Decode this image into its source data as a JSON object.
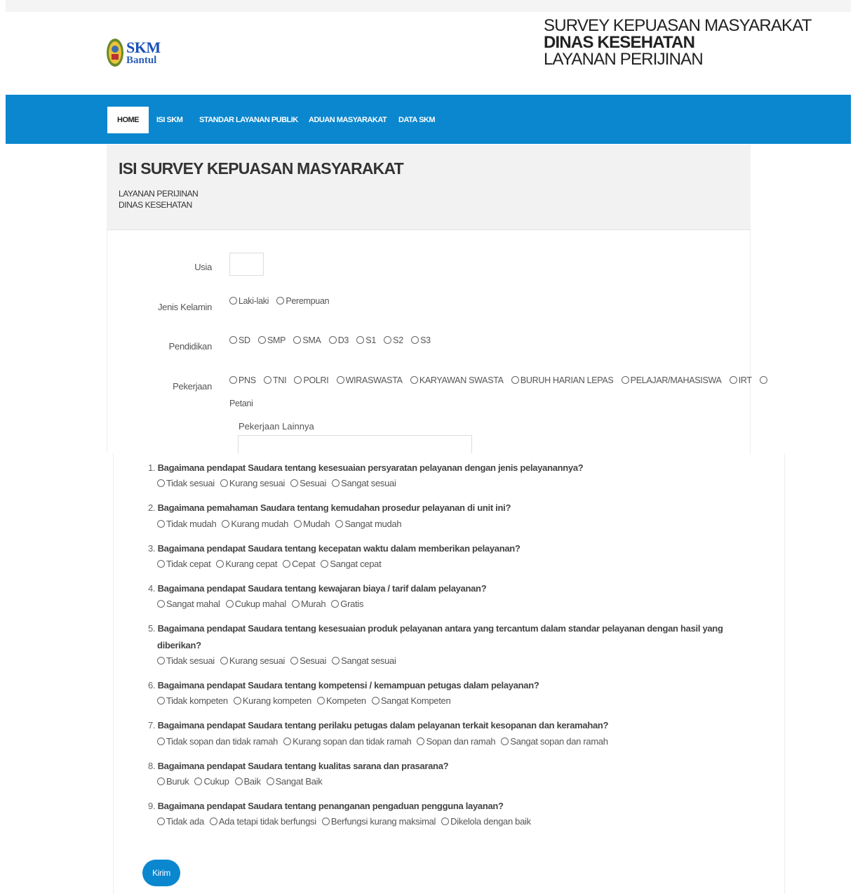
{
  "logo": {
    "line1": "SKM",
    "line2": "Bantul"
  },
  "header": {
    "line1": "SURVEY KEPUASAN MASYARAKAT",
    "line2": "DINAS KESEHATAN",
    "line3": "LAYANAN PERIJINAN"
  },
  "nav": [
    "HOME",
    "ISI SKM",
    "STANDAR LAYANAN PUBLIK",
    "ADUAN MASYARAKAT",
    "DATA SKM"
  ],
  "page": {
    "title": "ISI SURVEY KEPUASAN MASYARAKAT",
    "sub1": "LAYANAN PERIJINAN",
    "sub2": "DINAS KESEHATAN"
  },
  "form": {
    "usia_label": "Usia",
    "jk_label": "Jenis Kelamin",
    "jk_options": [
      "Laki-laki",
      "Perempuan"
    ],
    "pend_label": "Pendidikan",
    "pend_options": [
      "SD",
      "SMP",
      "SMA",
      "D3",
      "S1",
      "S2",
      "S3"
    ],
    "pek_label": "Pekerjaan",
    "pek_options": [
      "PNS",
      "TNI",
      "POLRI",
      "WIRASWASTA",
      "KARYAWAN SWASTA",
      "BURUH HARIAN LEPAS",
      "PELAJAR/MAHASISWA",
      "IRT"
    ],
    "pek_last": "Petani",
    "pek_other_label": "Pekerjaan Lainnya"
  },
  "questions": [
    {
      "num": "1.",
      "text": "Bagaimana pendapat Saudara tentang kesesuaian persyaratan pelayanan dengan jenis pelayanannya?",
      "options": [
        "Tidak sesuai",
        "Kurang sesuai",
        "Sesuai",
        "Sangat sesuai"
      ]
    },
    {
      "num": "2.",
      "text": "Bagaimana pemahaman Saudara tentang kemudahan prosedur pelayanan di unit ini?",
      "options": [
        "Tidak mudah",
        "Kurang mudah",
        "Mudah",
        "Sangat mudah"
      ]
    },
    {
      "num": "3.",
      "text": "Bagaimana pendapat Saudara tentang kecepatan waktu dalam memberikan pelayanan?",
      "options": [
        "Tidak cepat",
        "Kurang cepat",
        "Cepat",
        "Sangat cepat"
      ]
    },
    {
      "num": "4.",
      "text": "Bagaimana pendapat Saudara tentang kewajaran biaya / tarif dalam pelayanan?",
      "options": [
        "Sangat mahal",
        "Cukup mahal",
        "Murah",
        "Gratis"
      ]
    },
    {
      "num": "5.",
      "text": "Bagaimana pendapat Saudara tentang kesesuaian produk pelayanan antara yang tercantum dalam standar pelayanan dengan hasil yang diberikan?",
      "options": [
        "Tidak sesuai",
        "Kurang sesuai",
        "Sesuai",
        "Sangat sesuai"
      ]
    },
    {
      "num": "6.",
      "text": "Bagaimana pendapat Saudara tentang kompetensi / kemampuan petugas dalam pelayanan?",
      "options": [
        "Tidak kompeten",
        "Kurang kompeten",
        "Kompeten",
        "Sangat Kompeten"
      ]
    },
    {
      "num": "7.",
      "text": "Bagaimana pendapat Saudara tentang perilaku petugas dalam pelayanan terkait kesopanan dan keramahan?",
      "options": [
        "Tidak sopan dan tidak ramah",
        "Kurang sopan dan tidak ramah",
        "Sopan dan ramah",
        "Sangat sopan dan ramah"
      ]
    },
    {
      "num": "8.",
      "text": "Bagaimana pendapat Saudara tentang kualitas sarana dan prasarana?",
      "options": [
        "Buruk",
        "Cukup",
        "Baik",
        "Sangat Baik"
      ]
    },
    {
      "num": "9.",
      "text": "Bagaimana pendapat Saudara tentang penanganan pengaduan pengguna layanan?",
      "options": [
        "Tidak ada",
        "Ada tetapi tidak berfungsi",
        "Berfungsi kurang maksimal",
        "Dikelola dengan baik"
      ]
    }
  ],
  "submit_label": "Kirim",
  "colors": {
    "nav": "#0a87cf",
    "button": "#0a87cf"
  }
}
